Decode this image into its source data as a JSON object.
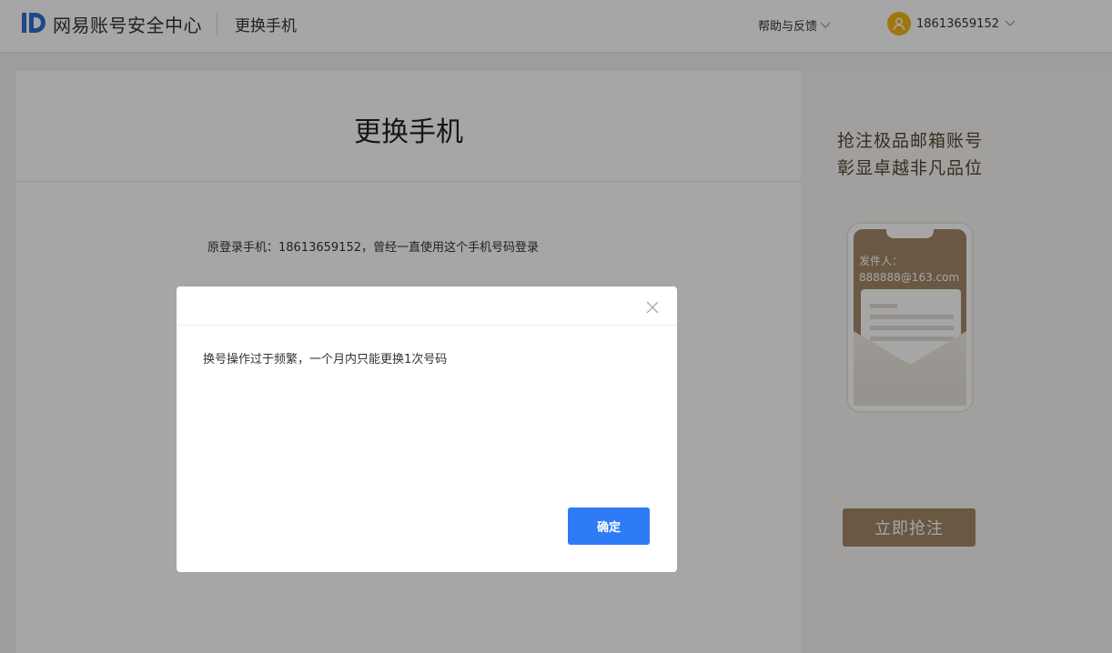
{
  "header": {
    "brand": "网易账号安全中心",
    "page_name": "更换手机",
    "help_label": "帮助与反馈",
    "username": "18613659152",
    "icons": {
      "logo": "netease-id-logo",
      "help_caret": "chevron-down-icon",
      "avatar": "user-avatar-icon",
      "user_caret": "chevron-down-icon"
    }
  },
  "card": {
    "title": "更换手机",
    "info": "原登录手机：18613659152，曾经一直使用这个手机号码登录"
  },
  "ad": {
    "line1": "抢注极品邮箱账号",
    "line2": "彰显卓越非凡品位",
    "sender_label": "发件人：",
    "sender_email": "888888@163.com",
    "cta_label": "立即抢注"
  },
  "modal": {
    "message": "换号操作过于频繁，一个月内只能更换1次号码",
    "confirm_label": "确定",
    "close_icon": "close-icon"
  },
  "colors": {
    "accent_blue": "#2d7cf5",
    "avatar": "#f3b71a",
    "ad_brown": "#a48766",
    "logo_blue": "#2f6fd3"
  }
}
